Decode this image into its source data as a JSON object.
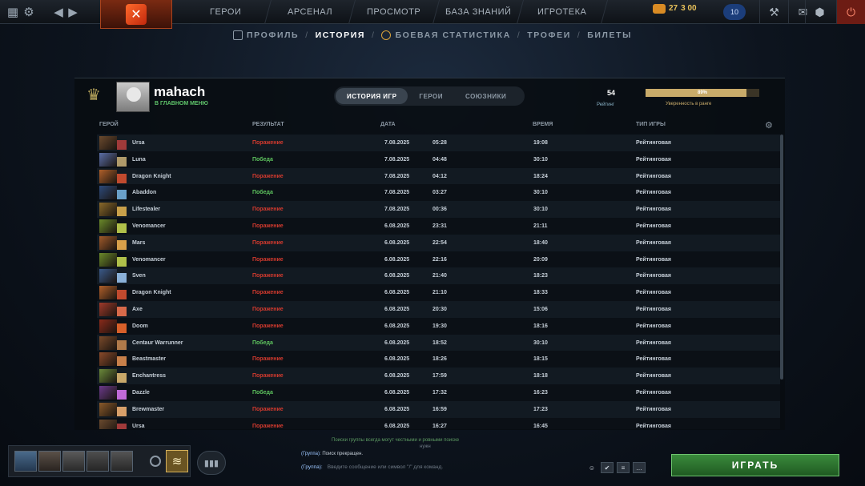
{
  "topnav": {
    "items": [
      "ГЕРОИ",
      "АРСЕНАЛ",
      "ПРОСМОТР",
      "БАЗА ЗНАНИЙ",
      "ИГРОТЕКА"
    ],
    "currency_top": "27",
    "currency_bottom": "3 00",
    "level": "10"
  },
  "subnav": {
    "items": [
      {
        "label": "ПРОФИЛЬ"
      },
      {
        "label": "ИСТОРИЯ"
      },
      {
        "label": "БОЕВАЯ СТАТИСТИКА"
      },
      {
        "label": "ТРОФЕИ"
      },
      {
        "label": "БИЛЕТЫ"
      }
    ],
    "separator": "/"
  },
  "profile": {
    "username": "mahach",
    "status": "В ГЛАВНОМ МЕНЮ",
    "rating_value": "54",
    "rating_label": "Рейтинг",
    "confidence_value": "89%",
    "confidence_fraction": 0.89,
    "confidence_label": "Уверенность в ранге"
  },
  "tabs": [
    "ИСТОРИЯ ИГР",
    "ГЕРОИ",
    "СОЮЗНИКИ"
  ],
  "table": {
    "headers": [
      "ГЕРОЙ",
      "РЕЗУЛЬТАТ",
      "ДАТА",
      "ВРЕМЯ",
      "ТИП ИГРЫ"
    ],
    "rows": [
      {
        "hero": "Ursa",
        "result": "Поражение",
        "date": "7.08.2025",
        "time": "05:28",
        "duration": "19:08",
        "type": "Рейтинговая",
        "win": false,
        "c1": "#6b4a2e",
        "c2": "#a03a3a"
      },
      {
        "hero": "Luna",
        "result": "Победа",
        "date": "7.08.2025",
        "time": "04:48",
        "duration": "30:10",
        "type": "Рейтинговая",
        "win": true,
        "c1": "#5a6ea8",
        "c2": "#b09a6a"
      },
      {
        "hero": "Dragon Knight",
        "result": "Поражение",
        "date": "7.08.2025",
        "time": "04:12",
        "duration": "18:24",
        "type": "Рейтинговая",
        "win": false,
        "c1": "#b0602a",
        "c2": "#c14a2e"
      },
      {
        "hero": "Abaddon",
        "result": "Победа",
        "date": "7.08.2025",
        "time": "03:27",
        "duration": "30:10",
        "type": "Рейтинговая",
        "win": true,
        "c1": "#2d4a7a",
        "c2": "#6aa0c8"
      },
      {
        "hero": "Lifestealer",
        "result": "Поражение",
        "date": "7.08.2025",
        "time": "00:36",
        "duration": "30:10",
        "type": "Рейтинговая",
        "win": false,
        "c1": "#8a6a2a",
        "c2": "#c8a04a"
      },
      {
        "hero": "Venomancer",
        "result": "Поражение",
        "date": "6.08.2025",
        "time": "23:31",
        "duration": "21:11",
        "type": "Рейтинговая",
        "win": false,
        "c1": "#6a8a2a",
        "c2": "#b0c04a"
      },
      {
        "hero": "Mars",
        "result": "Поражение",
        "date": "6.08.2025",
        "time": "22:54",
        "duration": "18:40",
        "type": "Рейтинговая",
        "win": false,
        "c1": "#a05a2a",
        "c2": "#d8a04a"
      },
      {
        "hero": "Venomancer",
        "result": "Поражение",
        "date": "6.08.2025",
        "time": "22:16",
        "duration": "20:09",
        "type": "Рейтинговая",
        "win": false,
        "c1": "#6a8a2a",
        "c2": "#b0c04a"
      },
      {
        "hero": "Sven",
        "result": "Поражение",
        "date": "6.08.2025",
        "time": "21:40",
        "duration": "18:23",
        "type": "Рейтинговая",
        "win": false,
        "c1": "#3a5a8a",
        "c2": "#8ab0d8"
      },
      {
        "hero": "Dragon Knight",
        "result": "Поражение",
        "date": "6.08.2025",
        "time": "21:10",
        "duration": "18:33",
        "type": "Рейтинговая",
        "win": false,
        "c1": "#b0602a",
        "c2": "#c14a2e"
      },
      {
        "hero": "Axe",
        "result": "Поражение",
        "date": "6.08.2025",
        "time": "20:30",
        "duration": "15:06",
        "type": "Рейтинговая",
        "win": false,
        "c1": "#a03a2a",
        "c2": "#d86a4a"
      },
      {
        "hero": "Doom",
        "result": "Поражение",
        "date": "6.08.2025",
        "time": "19:30",
        "duration": "18:16",
        "type": "Рейтинговая",
        "win": false,
        "c1": "#8a2a1a",
        "c2": "#d8602a"
      },
      {
        "hero": "Centaur Warrunner",
        "result": "Победа",
        "date": "6.08.2025",
        "time": "18:52",
        "duration": "30:10",
        "type": "Рейтинговая",
        "win": true,
        "c1": "#7a4a2a",
        "c2": "#b07a4a"
      },
      {
        "hero": "Beastmaster",
        "result": "Поражение",
        "date": "6.08.2025",
        "time": "18:26",
        "duration": "18:15",
        "type": "Рейтинговая",
        "win": false,
        "c1": "#8a4a2a",
        "c2": "#c8804a"
      },
      {
        "hero": "Enchantress",
        "result": "Поражение",
        "date": "6.08.2025",
        "time": "17:59",
        "duration": "18:18",
        "type": "Рейтинговая",
        "win": false,
        "c1": "#6a8a3a",
        "c2": "#c8a86a"
      },
      {
        "hero": "Dazzle",
        "result": "Победа",
        "date": "6.08.2025",
        "time": "17:32",
        "duration": "16:23",
        "type": "Рейтинговая",
        "win": true,
        "c1": "#6a3a8a",
        "c2": "#c06ad8"
      },
      {
        "hero": "Brewmaster",
        "result": "Поражение",
        "date": "6.08.2025",
        "time": "16:59",
        "duration": "17:23",
        "type": "Рейтинговая",
        "win": false,
        "c1": "#8a5a2a",
        "c2": "#d8a06a"
      },
      {
        "hero": "Ursa",
        "result": "Поражение",
        "date": "6.08.2025",
        "time": "16:27",
        "duration": "16:45",
        "type": "Рейтинговая",
        "win": false,
        "c1": "#6b4a2e",
        "c2": "#a03a3a"
      }
    ]
  },
  "chat": {
    "notice": "Поиски группы всегда могут честными и ровными поиске",
    "notice_sub": "нужн",
    "system_channel": "(Группа):",
    "system_msg": "Поиск прекращен.",
    "channel": "(Группа):",
    "placeholder": "Введите сообщение или символ \"/\" для команд."
  },
  "play_label": "ИГРАТЬ",
  "party_button": "▮▮▮",
  "colors": {
    "win": "#5ec45e",
    "loss": "#d23a2e",
    "play": "#2f7a31",
    "confidence": "#c9ab6a"
  }
}
